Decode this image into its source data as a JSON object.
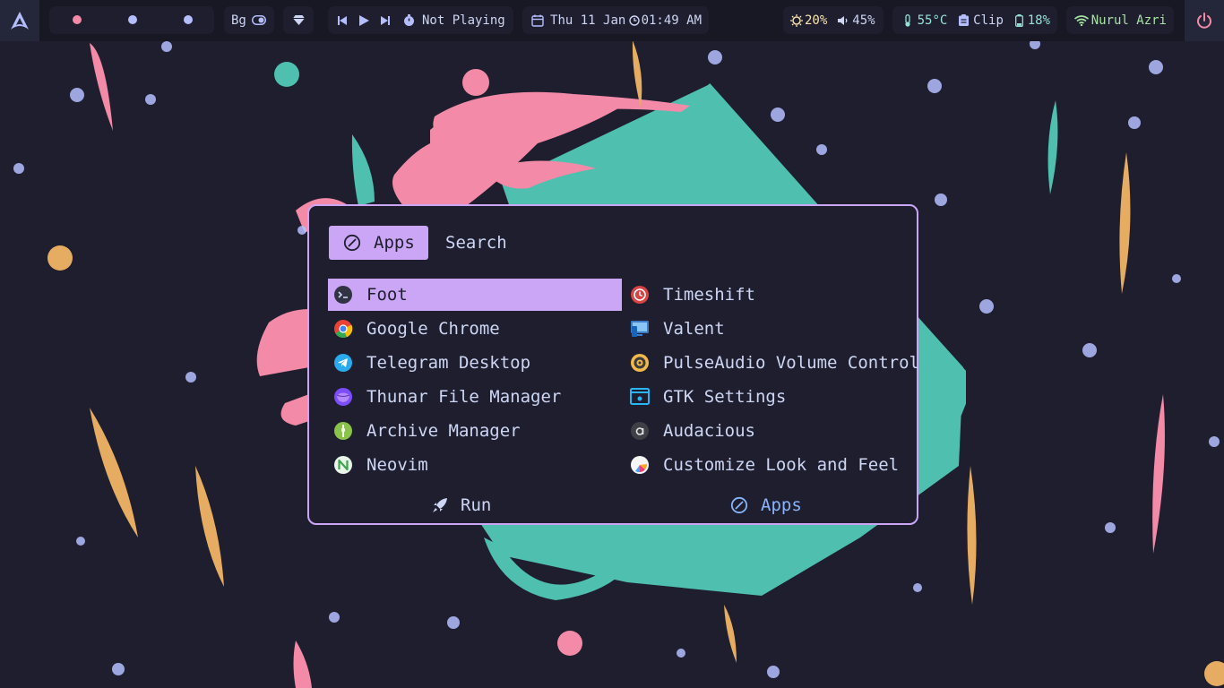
{
  "bar": {
    "workspace_dots": [
      "#f38ba8",
      "#b4befe",
      "#b4befe"
    ],
    "bg_label": "Bg",
    "media_status": "Not Playing",
    "date": "Thu 11 Jan",
    "time": "01:49 AM",
    "brightness": "20%",
    "volume": "45%",
    "temperature": "55°C",
    "clipboard": "Clip",
    "battery": "18%",
    "network_name": "Nurul Azri"
  },
  "launcher": {
    "tabs": [
      {
        "label": "Apps",
        "icon": "circle-slash-icon",
        "active": true
      },
      {
        "label": "Search",
        "active": false
      }
    ],
    "apps_left": [
      {
        "label": "Foot",
        "icon": "terminal-icon",
        "selected": true
      },
      {
        "label": "Google Chrome",
        "icon": "chrome-icon"
      },
      {
        "label": "Telegram Desktop",
        "icon": "telegram-icon"
      },
      {
        "label": "Thunar File Manager",
        "icon": "thunar-icon"
      },
      {
        "label": "Archive Manager",
        "icon": "archive-icon"
      },
      {
        "label": "Neovim",
        "icon": "neovim-icon"
      }
    ],
    "apps_right": [
      {
        "label": "Timeshift",
        "icon": "timeshift-icon"
      },
      {
        "label": "Valent",
        "icon": "valent-icon"
      },
      {
        "label": "PulseAudio Volume Control",
        "icon": "pulseaudio-icon"
      },
      {
        "label": "GTK Settings",
        "icon": "gtk-settings-icon"
      },
      {
        "label": "Audacious",
        "icon": "audacious-icon"
      },
      {
        "label": "Customize Look and Feel",
        "icon": "customize-icon"
      }
    ],
    "footer": [
      {
        "label": "Run",
        "icon": "rocket-icon"
      },
      {
        "label": "Apps",
        "icon": "circle-slash-icon"
      }
    ]
  },
  "colors": {
    "accent": "#cba6f7",
    "background": "#1e1e2e",
    "bar_background": "#181825",
    "pink": "#f38ba8",
    "teal": "#4fbfb0",
    "orange": "#e6ad62",
    "lavender": "#b4befe",
    "text": "#cdd6f4"
  }
}
